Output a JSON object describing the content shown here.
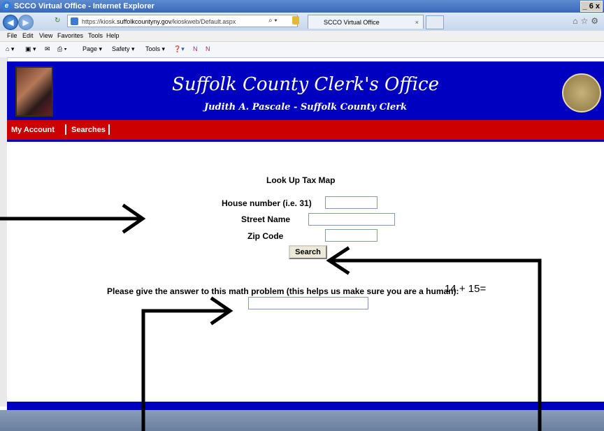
{
  "browser": {
    "window_title": "SCCO Virtual Office - Internet Explorer",
    "window_buttons": "_ 6 x",
    "address_prefix": "https://kiosk.",
    "address_domain": "suffolkcountyny.gov",
    "address_path": "/kioskweb/Default.aspx",
    "tab_title": "SCCO Virtual Office",
    "menu": [
      "File",
      "Edit",
      "View",
      "Favorites",
      "Tools",
      "Help"
    ],
    "command_bar": [
      "Page ▾",
      "Safety ▾",
      "Tools ▾"
    ]
  },
  "header": {
    "title": "Suffolk County Clerk's Office",
    "subtitle": "Judith A. Pascale - Suffolk County Clerk"
  },
  "nav": {
    "my_account": "My Account",
    "searches": "Searches"
  },
  "form": {
    "heading": "Look Up Tax Map",
    "house_number_label": "House number (i.e. 31)",
    "house_number_value": "",
    "street_name_label": "Street Name",
    "street_name_value": "",
    "zip_code_label": "Zip Code",
    "zip_code_value": "",
    "search_button": "Search"
  },
  "captcha": {
    "prompt": "Please give the answer to this math problem (this helps us make sure you are a human):",
    "problem": "14 + 15=",
    "answer_value": ""
  },
  "colors": {
    "header_blue": "#0000c0",
    "nav_red": "#cc0000"
  }
}
